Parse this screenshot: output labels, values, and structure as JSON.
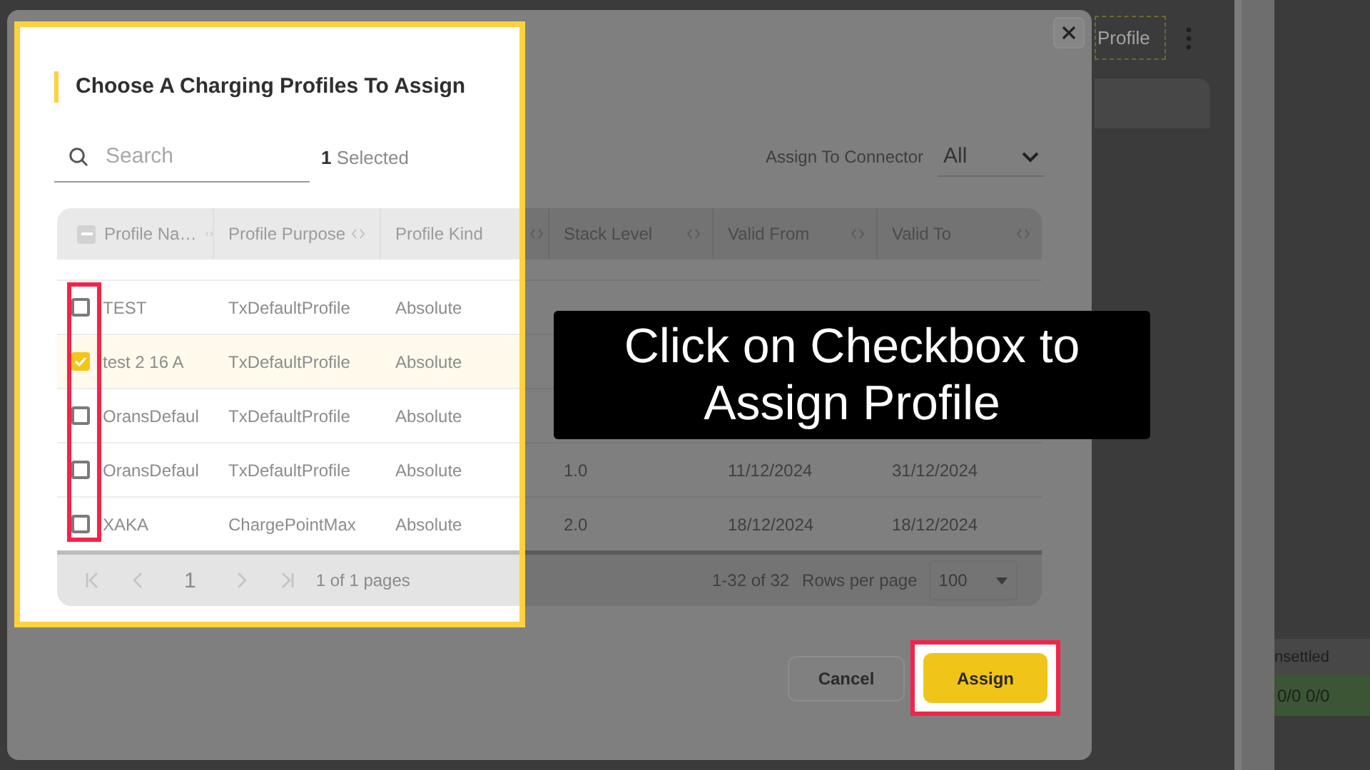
{
  "background": {
    "profile_button": "Profile",
    "status_header": "nsettled",
    "status_value": "0/0 0/0"
  },
  "dialog": {
    "title": "Choose A Charging Profiles To Assign",
    "search": {
      "placeholder": "Search"
    },
    "selected_text": "**1** Selected",
    "connector": {
      "label": "Assign To Connector",
      "value": "All"
    },
    "table": {
      "select_all_partial": true,
      "columns": [
        {
          "label": "Profile Na…"
        },
        {
          "label": "Profile Purpose"
        },
        {
          "label": "Profile Kind"
        },
        {
          "label": "Stack Level"
        },
        {
          "label": "Valid From"
        },
        {
          "label": "Valid To"
        }
      ],
      "rows": [
        {
          "checked": false,
          "name": "TEST",
          "purpose": "TxDefaultProfile",
          "kind": "Absolute"
        },
        {
          "checked": true,
          "name": "test 2 16 A",
          "purpose": "TxDefaultProfile",
          "kind": "Absolute"
        },
        {
          "checked": false,
          "name": "OransDefaul",
          "purpose": "TxDefaultProfile",
          "kind": "Absolute"
        },
        {
          "checked": false,
          "name": "OransDefaul",
          "purpose": "TxDefaultProfile",
          "kind": "Absolute",
          "stack_level": "1.0",
          "valid_from": "11/12/2024",
          "valid_to": "31/12/2024"
        },
        {
          "checked": false,
          "name": "XAKA",
          "purpose": "ChargePointMax",
          "kind": "Absolute",
          "stack_level": "2.0",
          "valid_from": "18/12/2024",
          "valid_to": "18/12/2024"
        }
      ]
    },
    "pagination": {
      "page": "1",
      "pages": "1 of 1 pages",
      "range": "1-32 of 32",
      "rows_per_page_label": "Rows per page",
      "rows_per_page": "100"
    },
    "buttons": [
      {
        "label": "Cancel",
        "kind": "secondary",
        "highlighted": false
      },
      {
        "label": "Assign",
        "kind": "primary",
        "highlighted": true
      }
    ]
  },
  "annotation": {
    "caption": "Click on Checkbox to Assign Profile",
    "highlight_checkboxes": true
  }
}
